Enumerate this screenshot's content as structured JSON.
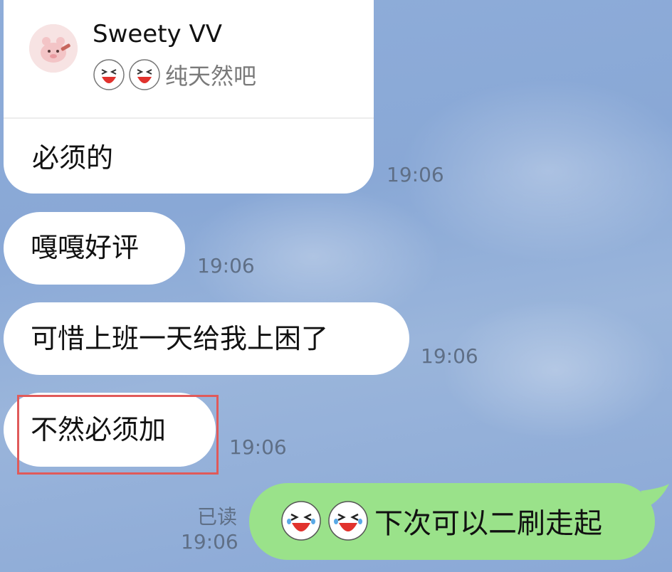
{
  "colors": {
    "chat_background": "#8fadd9",
    "received_bubble": "#ffffff",
    "sent_bubble": "#9ae28a",
    "highlight_border": "#e05a5a",
    "timestamp_text": "#5f6f86"
  },
  "reply": {
    "quoted_user": "Sweety VV",
    "quoted_emojis": [
      "laughing-emoji",
      "laughing-emoji"
    ],
    "quoted_text": "纯天然吧",
    "text": "必须的",
    "time": "19:06"
  },
  "messages": [
    {
      "text": "嘎嘎好评",
      "time": "19:06"
    },
    {
      "text": "可惜上班一天给我上困了",
      "time": "19:06"
    },
    {
      "text": "不然必须加",
      "time": "19:06"
    }
  ],
  "sent": {
    "emojis": [
      "laughing-crying-emoji",
      "laughing-crying-emoji"
    ],
    "text": "下次可以二刷走起",
    "read_label": "已读",
    "time": "19:06"
  }
}
